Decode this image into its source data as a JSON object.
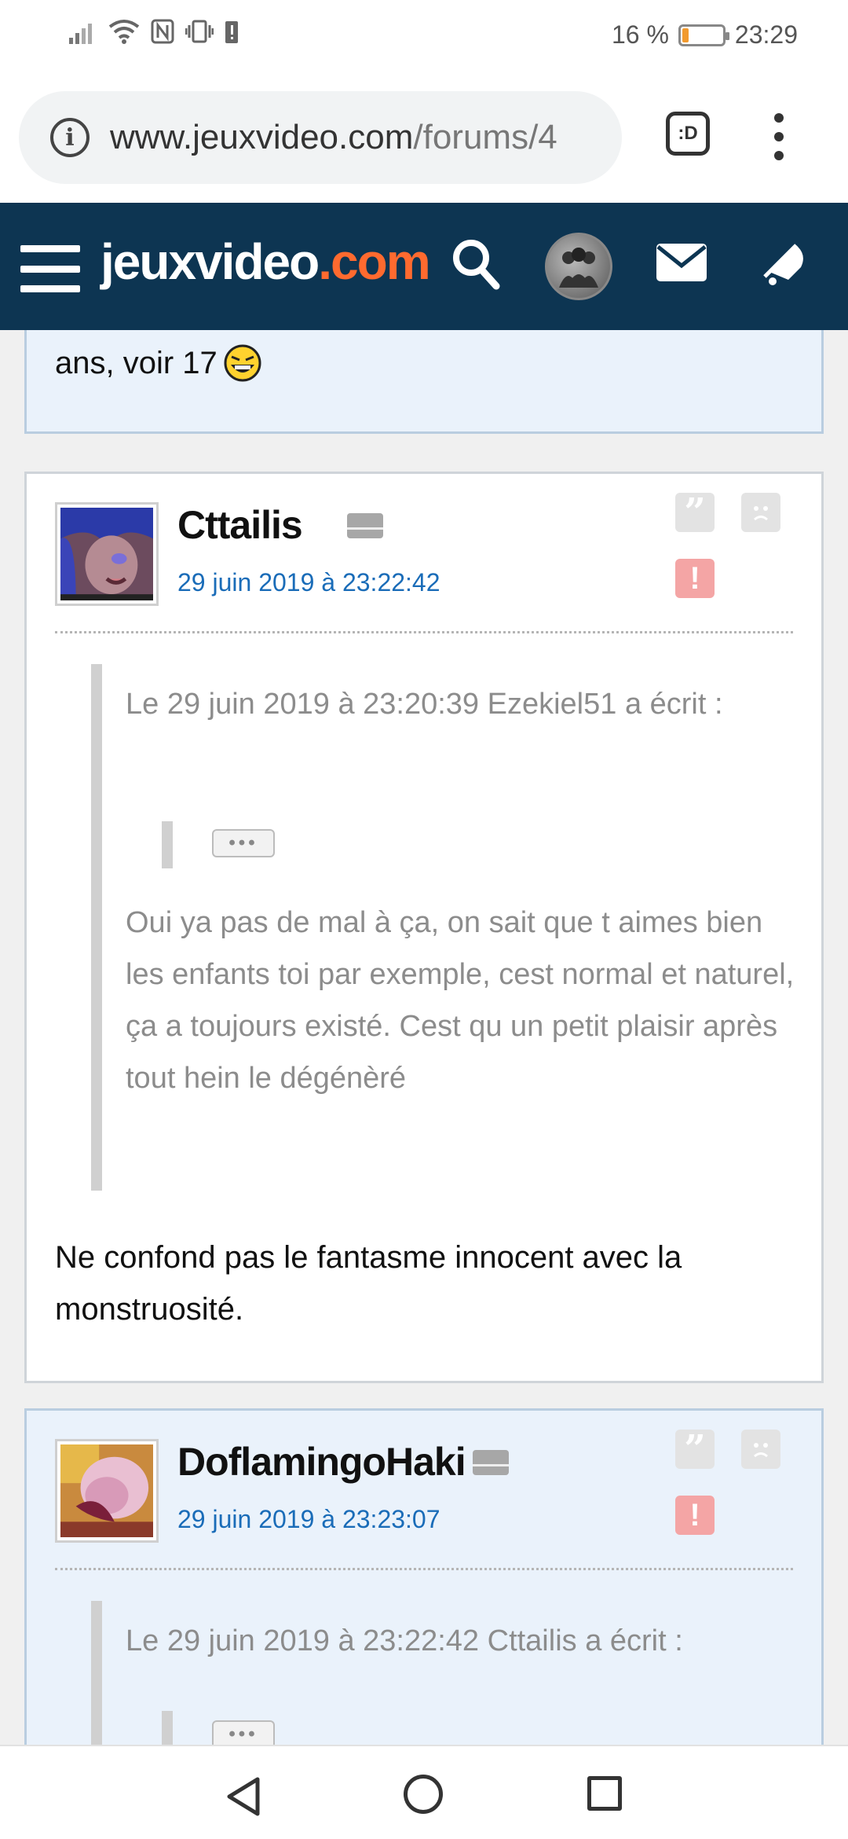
{
  "status": {
    "battery_text": "16 %",
    "battery_level": 0.16,
    "time": "23:29"
  },
  "browser": {
    "url_domain": "www.jeuxvideo.com",
    "url_path": "/forums/4",
    "tab_label": ":D"
  },
  "header": {
    "logo_main": "jeuxvideo",
    "logo_suffix": ".com",
    "colors": {
      "bg": "#0d3552",
      "accent": "#ff6a2f"
    }
  },
  "partial_post": {
    "text": "ans, voir 17"
  },
  "posts": [
    {
      "username": "Cttailis",
      "date": "29 juin 2019 à 23:22:42",
      "quote_header": "Le 29 juin 2019 à 23:20:39 Ezekiel51 a écrit :",
      "collapsed_label": "•••",
      "quote_body": "Oui ya pas de mal à ça, on sait que t aimes bien les enfants toi par exemple, cest normal et naturel, ça a toujours existé. Cest qu un petit plaisir après tout hein le dégénèré",
      "body": "Ne confond pas le fantasme innocent avec la monstruosité."
    },
    {
      "username": "DoflamingoHaki",
      "date": "29 juin 2019 à 23:23:07",
      "quote_header": "Le 29 juin 2019 à 23:22:42 Cttailis a écrit :",
      "collapsed_label": "•••"
    }
  ],
  "icons": {
    "quote": "”",
    "alert": "!"
  }
}
